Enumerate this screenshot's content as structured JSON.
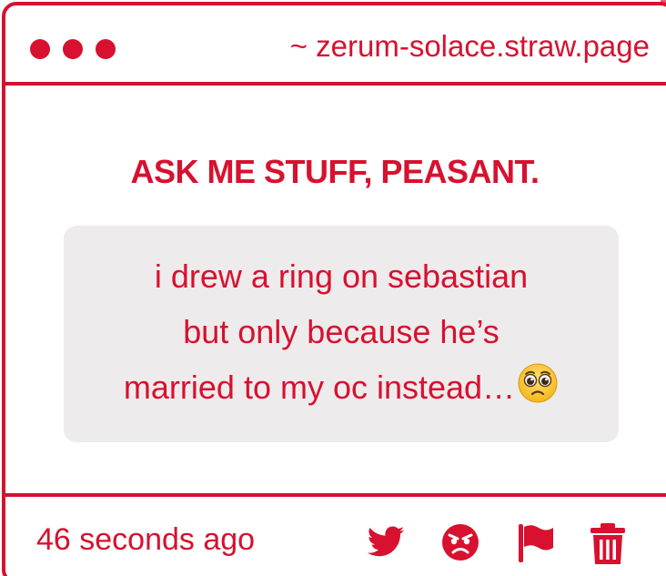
{
  "window": {
    "url": "~ zerum-solace.straw.page"
  },
  "main": {
    "heading": "ASK ME STUFF, PEASANT.",
    "question": {
      "lines": [
        "i drew a ring on sebastian",
        "but only because he’s",
        "married to my oc instead…"
      ],
      "emoji": "pleading-face"
    }
  },
  "footer": {
    "timestamp": "46 seconds ago",
    "actions": [
      "twitter-icon",
      "angry-face-icon",
      "flag-icon",
      "trash-icon"
    ]
  },
  "colors": {
    "accent": "#d7112f",
    "question_bg": "#eeebec",
    "background": "#ffffff"
  }
}
